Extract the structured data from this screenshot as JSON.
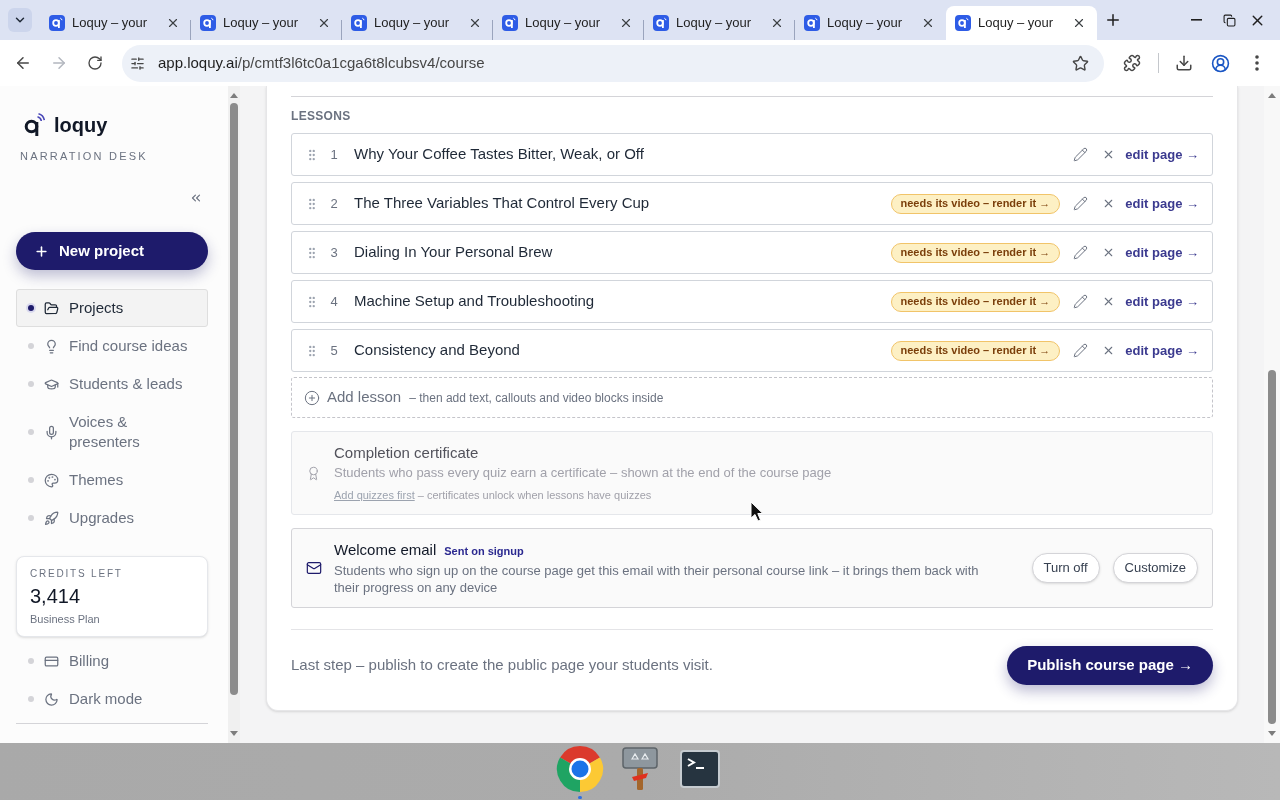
{
  "browser": {
    "tabs": [
      {
        "title": "Loquy – your",
        "selected": false
      },
      {
        "title": "Loquy – your",
        "selected": false
      },
      {
        "title": "Loquy – your",
        "selected": false
      },
      {
        "title": "Loquy – your",
        "selected": false
      },
      {
        "title": "Loquy – your",
        "selected": false
      },
      {
        "title": "Loquy – your",
        "selected": false
      },
      {
        "title": "Loquy – your",
        "selected": true
      }
    ],
    "nav": {
      "forward_disabled": true
    },
    "url": {
      "host": "app.loquy.ai",
      "path": "/p/cmtf3l6tc0a1cga6t8lcubsv4/course"
    }
  },
  "sidebar": {
    "logo": "loquy",
    "subtitle": "NARRATION DESK",
    "new_project": "New project",
    "nav_items": [
      {
        "label": "Projects",
        "selected": true
      },
      {
        "label": "Find course ideas",
        "selected": false
      },
      {
        "label": "Students & leads",
        "selected": false
      },
      {
        "label": "Voices & presenters",
        "selected": false
      },
      {
        "label": "Themes",
        "selected": false
      },
      {
        "label": "Upgrades",
        "selected": false
      }
    ],
    "credits": {
      "label": "CREDITS LEFT",
      "value": "3,414",
      "plan": "Business Plan"
    },
    "footer_items": [
      {
        "label": "Billing",
        "selected": false
      },
      {
        "label": "Dark mode",
        "selected": false
      }
    ]
  },
  "lessons": {
    "heading": "LESSONS",
    "items": [
      {
        "number": "1",
        "title": "Why Your Coffee Tastes Bitter, Weak, or Off",
        "edit": "edit page →"
      },
      {
        "number": "2",
        "title": "The Three Variables That Control Every Cup",
        "badge": "needs its video – render it →",
        "edit": "edit page →"
      },
      {
        "number": "3",
        "title": "Dialing In Your Personal Brew",
        "badge": "needs its video – render it →",
        "edit": "edit page →"
      },
      {
        "number": "4",
        "title": "Machine Setup and Troubleshooting",
        "badge": "needs its video – render it →",
        "edit": "edit page →"
      },
      {
        "number": "5",
        "title": "Consistency and Beyond",
        "badge": "needs its video – render it →",
        "edit": "edit page →"
      }
    ]
  },
  "add_lesson": {
    "label": "Add lesson",
    "hint": "– then add text, callouts and video blocks inside"
  },
  "certificate": {
    "title": "Completion certificate",
    "description": "Students who pass every quiz earn a certificate – shown at the end of the course page",
    "link": "Add quizzes first",
    "note": "– certificates unlock when lessons have quizzes",
    "disabled": true
  },
  "welcome_email": {
    "title": "Welcome email",
    "tag": "Sent on signup",
    "description": "Students who sign up on the course page get this email with their personal course link – it brings them back with their progress on any device",
    "buttons": [
      "Turn off",
      "Customize"
    ]
  },
  "publish": {
    "text": "Last step – publish to create the public page your students visit.",
    "button": "Publish course page →"
  },
  "taskbar": {
    "apps": [
      {
        "running": true
      },
      {
        "running": false
      },
      {
        "running": false
      }
    ]
  }
}
